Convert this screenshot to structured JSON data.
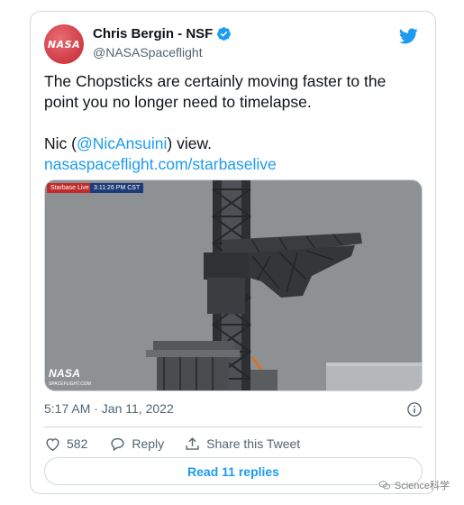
{
  "tweet": {
    "author": {
      "display_name": "Chris Bergin - NSF",
      "handle": "@NASASpaceflight",
      "avatar_text": "NASA"
    },
    "text_line1": "The Chopsticks are certainly moving faster to the point you no longer need to timelapse.",
    "text_prefix": "Nic (",
    "mention": "@NicAnsuini",
    "text_suffix": ") view.",
    "link": "nasaspaceflight.com/starbaselive",
    "media": {
      "label_left": "Starbase Live",
      "label_right": "3:11:26 PM CST",
      "watermark": "NASA",
      "watermark_sub": "SPACEFLIGHT.COM"
    },
    "timestamp": "5:17 AM · Jan 11, 2022",
    "actions": {
      "like_count": "582",
      "reply_label": "Reply",
      "share_label": "Share this Tweet"
    },
    "read_replies": "Read 11 replies"
  },
  "page_watermark": "Science科学",
  "colors": {
    "accent": "#1d9bf0",
    "text": "#0f1419",
    "muted": "#536471",
    "border": "#cfd9de"
  }
}
